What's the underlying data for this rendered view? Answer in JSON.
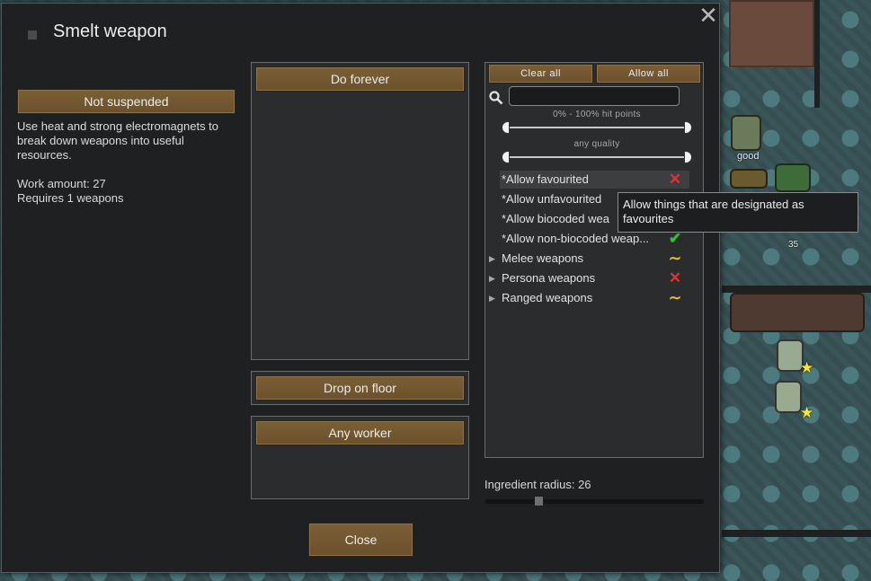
{
  "dialog": {
    "title": "Smelt weapon",
    "close_icon": "close-x-icon",
    "suspend_label": "Not suspended",
    "description": "Use heat and strong electromagnets to break down weapons into useful resources.",
    "work_amount": "Work amount: 27",
    "requires": "Requires 1 weapons",
    "repeat_mode_label": "Do forever",
    "store_mode_label": "Drop on floor",
    "worker_label": "Any worker",
    "close_label": "Close"
  },
  "filter": {
    "clear_all_label": "Clear all",
    "allow_all_label": "Allow all",
    "search_placeholder": "",
    "hit_points_label": "0% - 100% hit points",
    "quality_label": "any quality",
    "rows": [
      {
        "label": "*Allow favourited",
        "state": "disallowed"
      },
      {
        "label": "*Allow unfavourited",
        "state": "hidden-by-tooltip"
      },
      {
        "label": "*Allow biocoded wea",
        "state": "hidden-by-tooltip"
      },
      {
        "label": "*Allow non-biocoded weap...",
        "state": "allowed"
      },
      {
        "label": "Melee weapons",
        "state": "partial"
      },
      {
        "label": "Persona weapons",
        "state": "disallowed"
      },
      {
        "label": "Ranged weapons",
        "state": "partial"
      }
    ],
    "tooltip": "Allow things that are designated as favourites"
  },
  "ingredient": {
    "radius_label": "Ingredient radius: 26"
  },
  "world": {
    "pawn_label": "good",
    "count_label": "35"
  },
  "colors": {
    "button": "#7a5f36",
    "dialog_bg": "#1f2021",
    "disallowed": "#e53030",
    "allowed": "#28c828",
    "partial": "#e8c020"
  }
}
